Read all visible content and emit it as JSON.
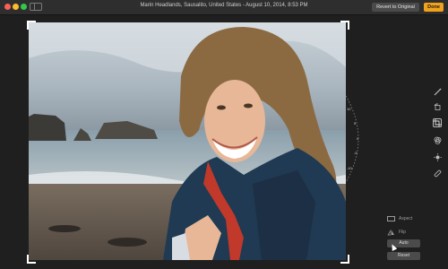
{
  "titlebar": {
    "title": "Marin Headlands, Sausalito, United States  -  August 10, 2014, 8:53 PM",
    "revert_label": "Revert to Original",
    "done_label": "Done"
  },
  "dial": {
    "ticks": [
      "10",
      "5",
      "0",
      "-5",
      "-10"
    ]
  },
  "toolbar": {
    "tools": [
      {
        "name": "magic-wand-icon",
        "glyph": "⟋",
        "active": false
      },
      {
        "name": "rotate-icon",
        "glyph": "↺",
        "active": false
      },
      {
        "name": "crop-icon",
        "glyph": "⌗",
        "active": true
      },
      {
        "name": "filters-icon",
        "glyph": "◉",
        "active": false
      },
      {
        "name": "adjust-icon",
        "glyph": "✺",
        "active": false
      },
      {
        "name": "retouch-icon",
        "glyph": "✎",
        "active": false
      }
    ]
  },
  "controls": {
    "aspect_label": "Aspect",
    "flip_label": "Flip",
    "auto_label": "Auto",
    "reset_label": "Reset"
  },
  "colors": {
    "done": "#f0a21b",
    "background": "#1f1f1f"
  }
}
